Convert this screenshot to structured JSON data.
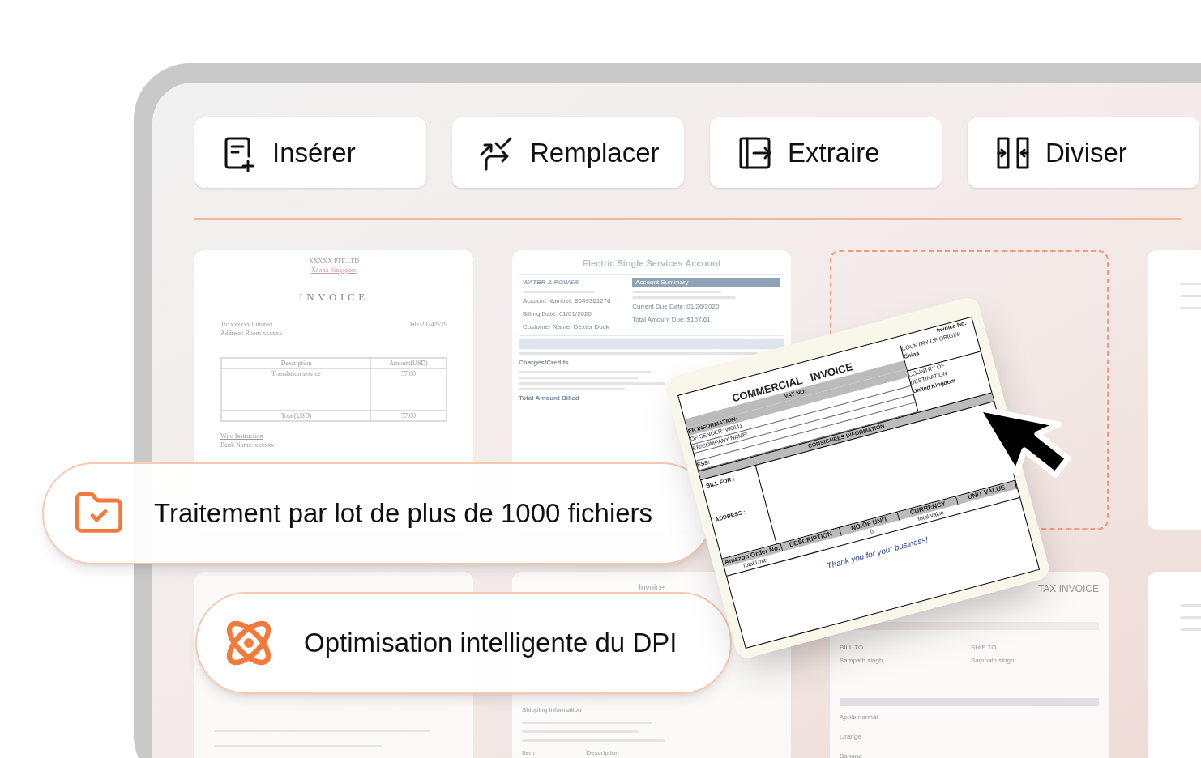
{
  "tools": [
    {
      "label": "Insérer"
    },
    {
      "label": "Remplacer"
    },
    {
      "label": "Extraire"
    },
    {
      "label": "Diviser"
    }
  ],
  "documents": [
    {
      "kind": "invoice",
      "lines": [
        "XXXXX PTE.LTD",
        "Xxxxx Singapore",
        "INVOICE",
        "To: xxxxxx Limited",
        "Date:2024/9/19",
        "Address: Room xxxxxx",
        "Description",
        "Amount(USD)",
        "Translation service",
        "57.00",
        "Total(USD)",
        "57.00",
        "Wire Instruction",
        "Bank Name: xxxxxx"
      ]
    },
    {
      "kind": "utility",
      "lines": [
        "Electric Single Services Account",
        "WATER & POWER",
        "Account Summary",
        "Account Number: 8649361276",
        "Billing Date: 01/01/2020",
        "Customer Name: Dexter Duck",
        "Current Due Date: 01/26/2020",
        "Total Amount Due: $157.61",
        "Charges/Credits",
        "Total Amount Billed"
      ]
    },
    {
      "kind": "dropzone"
    },
    {
      "kind": "edge"
    },
    {
      "kind": "faded"
    },
    {
      "kind": "shipping",
      "lines": [
        "Invoice",
        "Shipping Information",
        "Item",
        "Description"
      ]
    },
    {
      "kind": "tax",
      "lines": [
        "TAX INVOICE",
        "BILL TO",
        "SHIP TO",
        "Sampath singh",
        "Sampath singh",
        "Apple normal",
        "Orange",
        "Banana"
      ]
    },
    {
      "kind": "edge"
    }
  ],
  "features": [
    {
      "label": "Traitement par lot de plus de 1000 fichiers"
    },
    {
      "label": "Optimisation intelligente du DPI"
    }
  ],
  "dragged_document": {
    "invoice_no": "Invoice No.",
    "title": "COMMERCIAL   INVOICE",
    "vat": "VAT NO:",
    "origin": "COUNTRY OF ORIGIN:",
    "origin_value": "China",
    "destination": "COUNTRY OF DESTINATION",
    "destination_value": "United Kingdom",
    "shipper": "ER INFORMATION:",
    "sender": "OF SENDER: WOLU",
    "company": "ER/COMPANY NAME:",
    "address_cut": "ESS:",
    "consignees": "CONSIGNEES INFORMATION",
    "bill_for": "BILL FOR :",
    "address": "ADDRESS :",
    "columns": [
      "Amazon Order No:",
      "DESCRIPTION",
      "NO.OF UNIT",
      "CURRENCY",
      "UNIT VALUE"
    ],
    "total_unit": "Total Unit:",
    "zero": "0",
    "total_value": "Total Value",
    "thanks": "Thank you for your business!"
  }
}
